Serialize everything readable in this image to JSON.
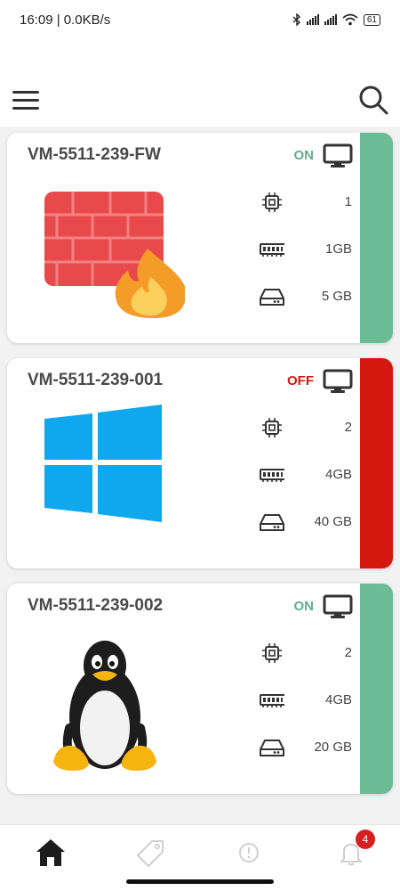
{
  "status_bar": {
    "time_speed": "16:09 | 0.0KB/s",
    "battery": "61"
  },
  "app_bar": {
    "menu_icon": "hamburger-menu-icon",
    "search_icon": "search-icon"
  },
  "vms": [
    {
      "name": "VM-5511-239-FW",
      "state": "ON",
      "state_color": "#5fae8c",
      "stripe_color": "#6bbb94",
      "os_icon": "firewall-icon",
      "cpu": "1",
      "ram": "1GB",
      "disk": "5 GB"
    },
    {
      "name": "VM-5511-239-001",
      "state": "OFF",
      "state_color": "#d21a12",
      "stripe_color": "#d5180f",
      "os_icon": "windows-logo-icon",
      "cpu": "2",
      "ram": "4GB",
      "disk": "40 GB"
    },
    {
      "name": "VM-5511-239-002",
      "state": "ON",
      "state_color": "#5fae8c",
      "stripe_color": "#6bbb94",
      "os_icon": "linux-tux-icon",
      "cpu": "2",
      "ram": "4GB",
      "disk": "20 GB"
    }
  ],
  "bottom_nav": {
    "items": [
      "home-icon",
      "tag-icon",
      "alert-circle-icon",
      "bell-icon"
    ],
    "notification_count": "4"
  },
  "colors": {
    "on": "#6bbb94",
    "off": "#d5180f",
    "badge": "#d71f1f"
  }
}
